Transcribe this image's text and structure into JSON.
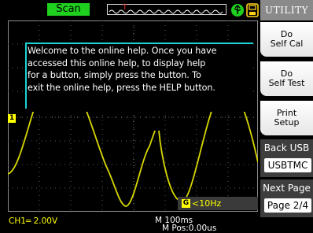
{
  "status": {
    "mode": "Scan"
  },
  "help": {
    "lines": [
      "Welcome to the online help. Once you have",
      "accessed this online help, to display help",
      "for a button, simply press the button. To",
      "exit the online help, press the HELP button."
    ]
  },
  "menu": {
    "title": "UTILITY",
    "do_self_cal": [
      "Do",
      "Self Cal"
    ],
    "do_self_test": [
      "Do",
      "Self Test"
    ],
    "print_setup": [
      "Print",
      "Setup"
    ],
    "back_usb_label": "Back USB",
    "back_usb_value": "USBTMC",
    "next_page_label": "Next Page",
    "next_page_value": "Page 2/4"
  },
  "channel": {
    "marker": "1",
    "scale": "CH1═ 2.00V"
  },
  "trigger": {
    "marker": "T"
  },
  "frequency": {
    "icon": "G",
    "readout": "<10Hz"
  },
  "timebase": {
    "scale": "M 100ms",
    "position": "M Pos:0.00us"
  },
  "icons": {
    "usb": "usb-icon",
    "disk": "disk-icon"
  },
  "colors": {
    "accent_green": "#1fd01f",
    "trace_yellow": "#ffff00",
    "help_border": "#1ad4d4"
  }
}
